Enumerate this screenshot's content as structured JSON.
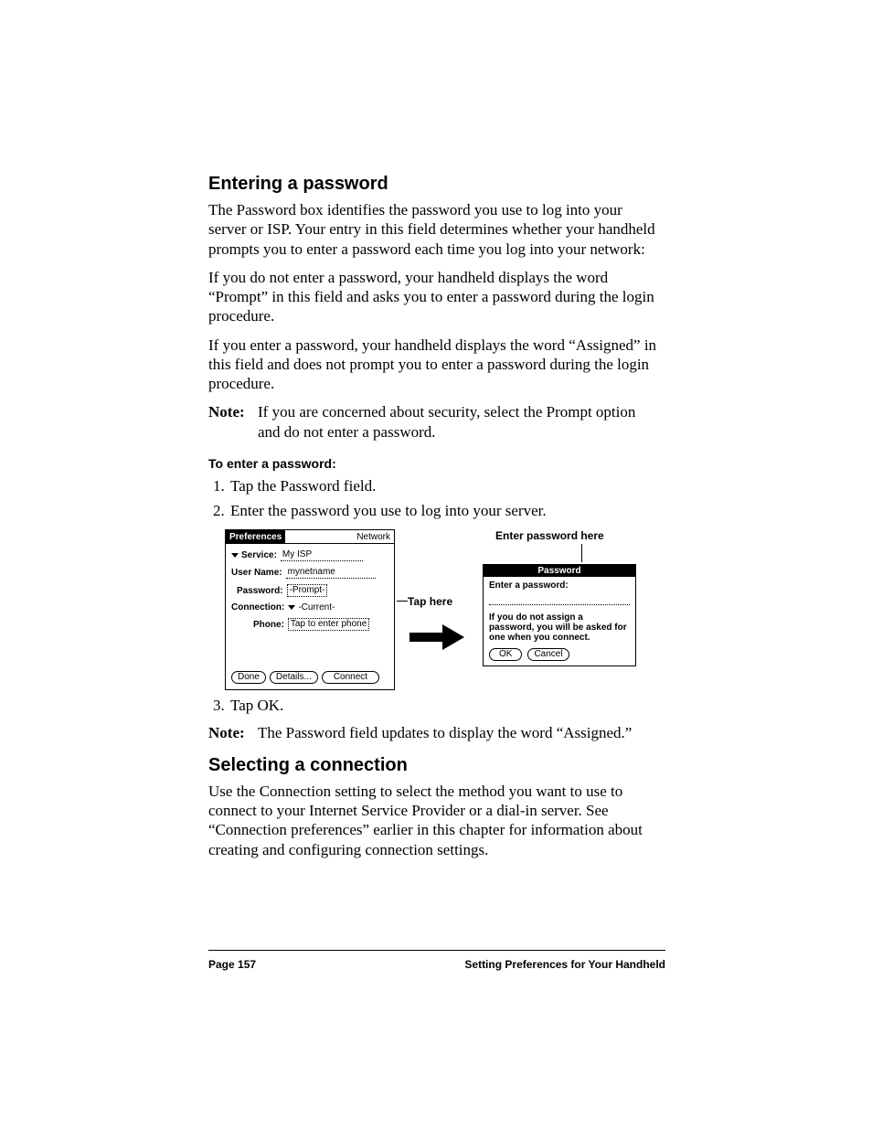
{
  "section1_title": "Entering a password",
  "section1_intro": "The Password box identifies the password you use to log into your server or ISP. Your entry in this field determines whether your handheld prompts you to enter a password each time you log into your network:",
  "section1_bul1": "If you do not enter a password, your handheld displays the word “Prompt” in this field and asks you to enter a password during the login procedure.",
  "section1_bul2": "If you enter a password, your handheld displays the word “Assigned” in this field and does not prompt you to enter a password during the login procedure.",
  "note_label": "Note:",
  "note1_text": "If you are concerned about security, select the Prompt option and do not enter a password.",
  "subhead": "To enter a password:",
  "step1": "Tap the Password field.",
  "step2": "Enter the password you use to log into your server.",
  "step3": "Tap OK.",
  "note2_text": "The Password field updates to display the word “Assigned.”",
  "section2_title": "Selecting a connection",
  "section2_body": "Use the Connection setting to select the method you want to use to connect to your Internet Service Provider or a dial-in server. See “Connection preferences” earlier in this chapter for information about creating and configuring connection settings.",
  "footer_left": "Page 157",
  "footer_right": "Setting Preferences for Your Handheld",
  "callout_tap": "Tap here",
  "callout_enter": "Enter password here",
  "palm": {
    "title_left": "Preferences",
    "title_right": "Network",
    "service_label": "Service:",
    "service_value": "My ISP",
    "username_label": "User Name:",
    "username_value": "mynetname",
    "password_label": "Password:",
    "password_value": "-Prompt-",
    "connection_label": "Connection:",
    "connection_value": "-Current-",
    "phone_label": "Phone:",
    "phone_value": "Tap to enter phone",
    "btn_done": "Done",
    "btn_details": "Details...",
    "btn_connect": "Connect"
  },
  "dialog": {
    "title": "Password",
    "prompt": "Enter a password:",
    "hint": "If you do not assign a password, you will be asked for one when you connect.",
    "btn_ok": "OK",
    "btn_cancel": "Cancel"
  }
}
